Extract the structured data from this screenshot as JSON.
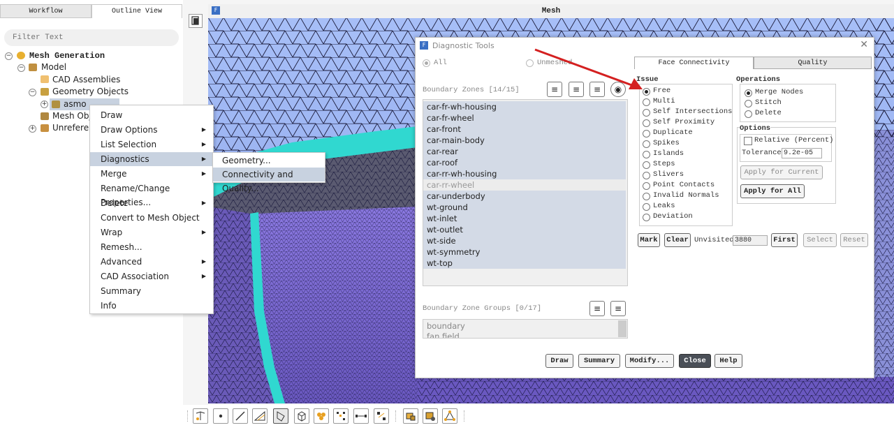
{
  "left_panel": {
    "tabs": [
      "Workflow",
      "Outline View"
    ],
    "filter_placeholder": "Filter Text",
    "tree": {
      "root": "Mesh Generation",
      "model": "Model",
      "cad_assemblies": "CAD Assemblies",
      "geometry_objects": "Geometry Objects",
      "asmo": "asmo",
      "mesh_objects": "Mesh Obje",
      "unreferenced": "Unreferen"
    }
  },
  "context_menu": {
    "items": [
      "Draw",
      "Draw Options",
      "List Selection",
      "Diagnostics",
      "Merge",
      "Rename/Change Properties...",
      "Delete",
      "Convert to Mesh Object",
      "Wrap",
      "Remesh...",
      "Advanced",
      "CAD Association",
      "Summary",
      "Info"
    ],
    "submenu": [
      "Geometry...",
      "Connectivity and Quality..."
    ]
  },
  "viewport": {
    "title": "Mesh"
  },
  "dialog": {
    "title": "Diagnostic Tools",
    "scope_all": "All",
    "scope_unmeshed": "Unmeshed",
    "boundary_zones_label": "Boundary Zones [14/15]",
    "boundary_zones": [
      "car-fr-wh-housing",
      "car-fr-wheel",
      "car-front",
      "car-main-body",
      "car-rear",
      "car-roof",
      "car-rr-wh-housing",
      "car-rr-wheel",
      "car-underbody",
      "wt-ground",
      "wt-inlet",
      "wt-outlet",
      "wt-side",
      "wt-symmetry",
      "wt-top"
    ],
    "zone_groups_label": "Boundary Zone Groups [0/17]",
    "zone_groups": [
      "boundary",
      "fan field"
    ],
    "tabs": [
      "Face Connectivity",
      "Quality"
    ],
    "issue_label": "Issue",
    "issues": [
      "Free",
      "Multi",
      "Self Intersections",
      "Self Proximity",
      "Duplicate",
      "Spikes",
      "Islands",
      "Steps",
      "Slivers",
      "Point Contacts",
      "Invalid Normals",
      "Leaks",
      "Deviation"
    ],
    "operations_label": "Operations",
    "operations": [
      "Merge Nodes",
      "Stitch",
      "Delete"
    ],
    "options_label": "Options",
    "relative_label": "Relative (Percent)",
    "tolerance_label": "Tolerance",
    "tolerance_value": "9.2e-05",
    "apply_current": "Apply for Current",
    "apply_all": "Apply for All",
    "mark": "Mark",
    "clear": "Clear",
    "unvisited_label": "Unvisited",
    "unvisited_value": "3880",
    "first": "First",
    "select": "Select",
    "reset": "Reset",
    "footer": [
      "Draw",
      "Summary",
      "Modify...",
      "Close",
      "Help"
    ]
  },
  "colors": {
    "mesh_light": "#9ab4f0",
    "mesh_dark": "#7060c8",
    "cyan_edge": "#40e0d0",
    "arrow": "#d42020"
  }
}
